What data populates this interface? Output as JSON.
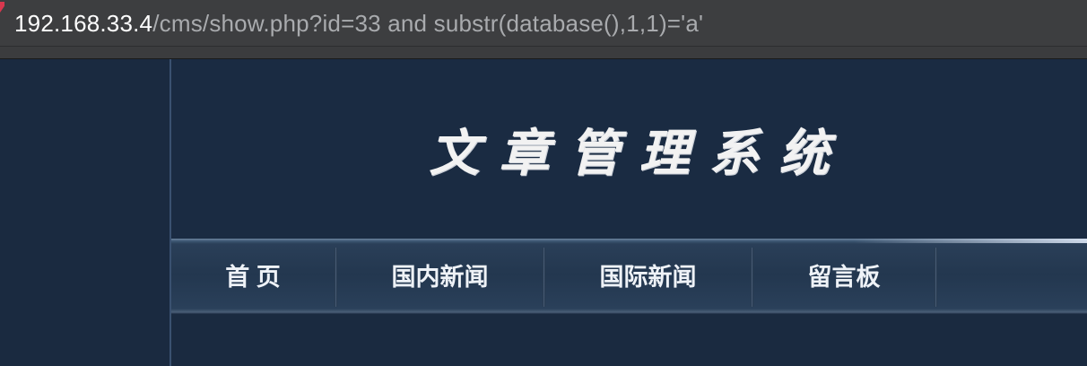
{
  "address_bar": {
    "host": "192.168.33.4",
    "path": "/cms/show.php?id=33 and substr(database(),1,1)='a'"
  },
  "site": {
    "title": "文章管理系统"
  },
  "nav": {
    "items": [
      {
        "label": "首 页"
      },
      {
        "label": "国内新闻"
      },
      {
        "label": "国际新闻"
      },
      {
        "label": "留言板"
      }
    ]
  }
}
